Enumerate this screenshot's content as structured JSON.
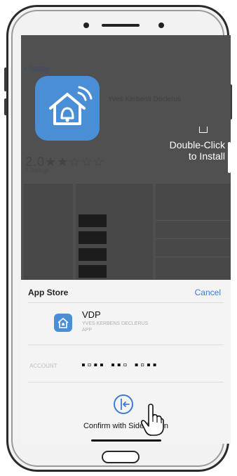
{
  "background_app": {
    "back_label": "Today",
    "developer_blurb": "Yves Kerbens Declerus",
    "rating_text": "2.0★★☆☆☆",
    "rating_sub": "2 Ratings",
    "double_click_hint": [
      "Double-Click",
      "to Install"
    ]
  },
  "sheet": {
    "title": "App Store",
    "cancel_label": "Cancel",
    "app_name": "VDP",
    "app_developer": "YVES KERBENS DECLERUS",
    "app_type": "APP",
    "account_label": "ACCOUNT",
    "account_value": "▪▫▪▪ ▪▪▫  ▪▫▪▪",
    "confirm_label": "Confirm with Side Button"
  },
  "colors": {
    "accent": "#3c7bd6",
    "app_icon": "#4a8fd6"
  }
}
